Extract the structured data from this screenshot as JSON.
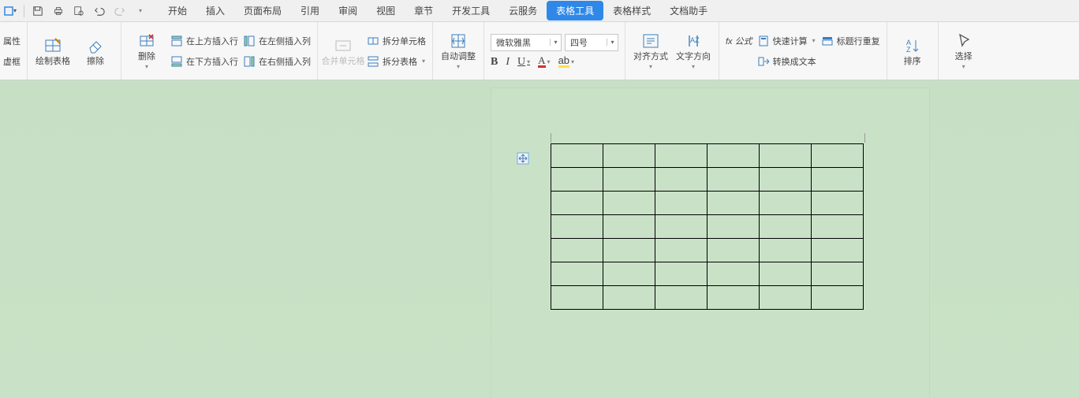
{
  "qat": {
    "file_drop": "▾"
  },
  "menu": {
    "tabs": [
      {
        "label": "开始"
      },
      {
        "label": "插入"
      },
      {
        "label": "页面布局"
      },
      {
        "label": "引用"
      },
      {
        "label": "审阅"
      },
      {
        "label": "视图"
      },
      {
        "label": "章节"
      },
      {
        "label": "开发工具"
      },
      {
        "label": "云服务"
      },
      {
        "label": "表格工具",
        "active": true
      },
      {
        "label": "表格样式"
      },
      {
        "label": "文档助手"
      }
    ]
  },
  "ribbon": {
    "properties": "属性",
    "virtual_box": "虚框",
    "draw_table": "绘制表格",
    "erase": "擦除",
    "delete": "删除",
    "insert_row_above": "在上方插入行",
    "insert_row_below": "在下方插入行",
    "insert_col_left": "在左侧插入列",
    "insert_col_right": "在右侧插入列",
    "merge_cells": "合并单元格",
    "split_cells": "拆分单元格",
    "split_table": "拆分表格",
    "auto_fit": "自动调整",
    "font_name": "微软雅黑",
    "font_size": "四号",
    "align": "对齐方式",
    "text_dir": "文字方向",
    "formula": "fx 公式",
    "quick_calc": "快速计算",
    "header_repeat": "标题行重复",
    "to_text": "转换成文本",
    "sort": "排序",
    "select": "选择"
  },
  "dropdown_glyph": "▾",
  "table": {
    "rows": 7,
    "cols": 6
  }
}
